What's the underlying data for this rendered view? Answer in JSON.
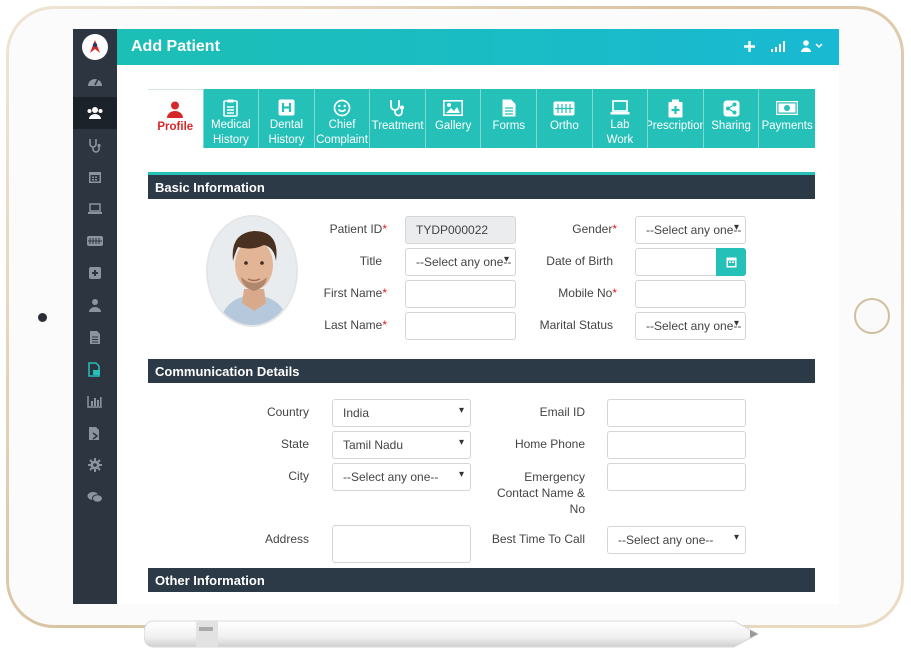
{
  "app": {
    "title": "Add Patient"
  },
  "tabs": [
    {
      "icon": "user-icon",
      "label": "Profile",
      "active": true
    },
    {
      "icon": "clipboard-icon",
      "label": "Medical History"
    },
    {
      "icon": "hospital-icon",
      "label": "Dental History"
    },
    {
      "icon": "smile-icon",
      "label": "Chief Complaint"
    },
    {
      "icon": "stethoscope-icon",
      "label": "Treatment"
    },
    {
      "icon": "image-icon",
      "label": "Gallery"
    },
    {
      "icon": "file-icon",
      "label": "Forms"
    },
    {
      "icon": "braces-icon",
      "label": "Ortho"
    },
    {
      "icon": "laptop-icon",
      "label": "Lab Work"
    },
    {
      "icon": "prescription-icon",
      "label": "Prescription"
    },
    {
      "icon": "share-icon",
      "label": "Sharing"
    },
    {
      "icon": "money-icon",
      "label": "Payments"
    }
  ],
  "basic": {
    "heading": "Basic Information",
    "patient_id_label": "Patient ID",
    "patient_id_value": "TYDP000022",
    "title_label": "Title",
    "title_value": "--Select any one--",
    "first_name_label": "First Name",
    "last_name_label": "Last Name",
    "gender_label": "Gender",
    "gender_value": "--Select any one--",
    "dob_label": "Date of Birth",
    "mobile_label": "Mobile No",
    "marital_label": "Marital Status",
    "marital_value": "--Select any one--"
  },
  "comm": {
    "heading": "Communication Details",
    "country_label": "Country",
    "country_value": "India",
    "state_label": "State",
    "state_value": "Tamil Nadu",
    "city_label": "City",
    "city_value": "--Select any one--",
    "address_label": "Address",
    "email_label": "Email ID",
    "home_phone_label": "Home Phone",
    "emergency_label_1": "Emergency",
    "emergency_label_2": "Contact Name &",
    "emergency_label_3": "No",
    "best_time_label": "Best Time To Call",
    "best_time_value": "--Select any one--"
  },
  "other": {
    "heading": "Other Information"
  },
  "colors": {
    "accent": "#25c1b9",
    "sidebar": "#2c3540",
    "section": "#2c3a47",
    "active_tab": "#d62828"
  }
}
